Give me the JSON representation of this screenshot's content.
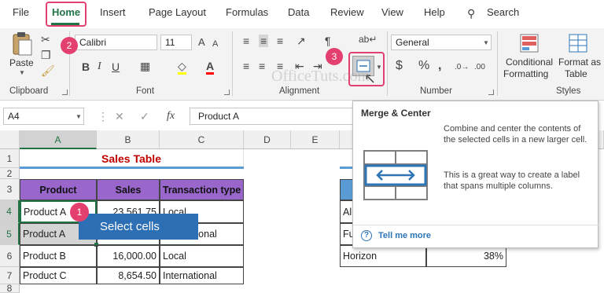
{
  "tabs": [
    "File",
    "Home",
    "Insert",
    "Page Layout",
    "Formulas",
    "Data",
    "Review",
    "View",
    "Help"
  ],
  "search_label": "Search",
  "ribbon": {
    "paste_label": "Paste",
    "font_name": "Calibri",
    "font_size": "11",
    "grow_font": "A",
    "shrink_font": "A",
    "font_color_letter": "A",
    "number_format": "General",
    "currency_symbol": "$",
    "percent_symbol": "%",
    "comma_symbol": ",",
    "conditional_formatting": [
      "Conditional",
      "Formatting"
    ],
    "format_as_table": [
      "Format as",
      "Table"
    ],
    "groups": {
      "clipboard": "Clipboard",
      "font": "Font",
      "alignment": "Alignment",
      "number": "Number",
      "styles": "Styles"
    }
  },
  "watermark": "OfficeTuts.com",
  "formula_bar": {
    "name_box": "A4",
    "fx": "fx",
    "value": "Product A"
  },
  "columns": [
    "A",
    "B",
    "C",
    "D",
    "E"
  ],
  "rows": [
    "1",
    "2",
    "3",
    "4",
    "5",
    "6",
    "7",
    "8"
  ],
  "sheet": {
    "title": "Sales Table",
    "headers": [
      "Product",
      "Sales",
      "Transaction type"
    ],
    "data": [
      [
        "Product A",
        "23,561.75",
        "Local"
      ],
      [
        "Product A",
        "",
        "International"
      ],
      [
        "Product B",
        "16,000.00",
        "Local"
      ],
      [
        "Product C",
        "8,654.50",
        "International"
      ]
    ],
    "right_cells": [
      "Al",
      "Fu",
      "Horizon",
      "38%"
    ]
  },
  "tooltip": {
    "title": "Merge & Center",
    "description1": "Combine and center the contents of the selected cells in a new larger cell.",
    "description2": "This is a great way to create a label that spans multiple columns.",
    "tell_me_more": "Tell me more"
  },
  "callout": "Select cells",
  "steps": [
    "1",
    "2",
    "3"
  ],
  "colors": {
    "accent_green": "#217346",
    "highlight_pink": "#e4406f",
    "header_purple": "#9966cc",
    "title_red": "#c00000",
    "callout_blue": "#2c6fb5",
    "merge_icon_blue": "#2e75b6"
  }
}
